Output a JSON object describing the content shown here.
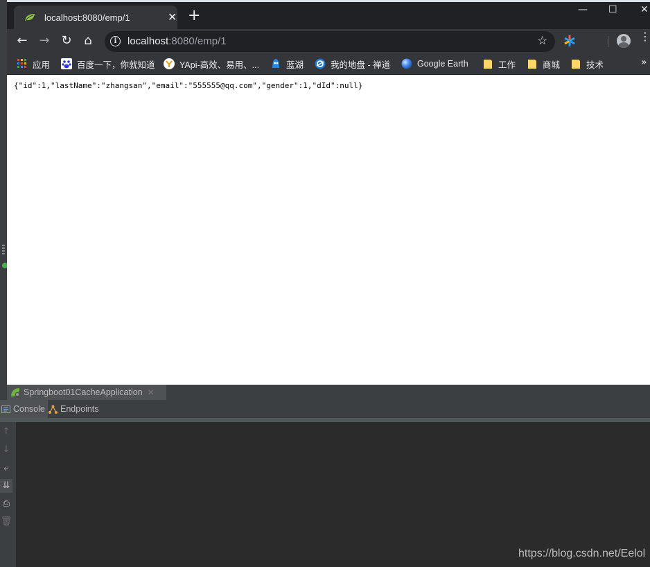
{
  "browser": {
    "tab": {
      "title": "localhost:8080/emp/1",
      "close": "✕"
    },
    "new_tab": "+",
    "window_controls": {
      "minimize": "—",
      "maximize": "☐",
      "close": "✕"
    },
    "toolbar": {
      "back": "←",
      "forward": "→",
      "reload": "↻",
      "home": "⌂",
      "url_host": "localhost",
      "url_path": ":8080/emp/1",
      "info": "i",
      "star": "☆",
      "menu": "⋮"
    },
    "bookmarks": [
      {
        "label": "应用",
        "icon": "apps-grid-icon"
      },
      {
        "label": "百度一下，你就知道",
        "icon": "baidu-paw-icon"
      },
      {
        "label": "YApi-高效、易用、...",
        "icon": "yapi-icon"
      },
      {
        "label": "蓝湖",
        "icon": "lanhu-icon"
      },
      {
        "label": "我的地盘 - 禅道",
        "icon": "zentao-icon"
      },
      {
        "label": "Google Earth",
        "icon": "google-earth-icon"
      },
      {
        "label": "工作",
        "icon": "folder-icon"
      },
      {
        "label": "商城",
        "icon": "folder-icon"
      },
      {
        "label": "技术",
        "icon": "folder-icon"
      }
    ],
    "bookmarks_more": "»",
    "page_body": "{\"id\":1,\"lastName\":\"zhangsan\",\"email\":\"555555@qq.com\",\"gender\":1,\"dId\":null}"
  },
  "ide": {
    "run_tab": {
      "label": "Springboot01CacheApplication",
      "close": "✕"
    },
    "sub_tabs": [
      {
        "label": "Console",
        "active": true
      },
      {
        "label": "Endpoints",
        "active": false
      }
    ],
    "gutter_buttons": [
      "↑",
      "↓",
      "⤶",
      "⇊",
      "⎙",
      "🗑"
    ]
  },
  "watermark": "https://blog.csdn.net/Eelol",
  "colors": {
    "chrome_dark": "#202124",
    "chrome_toolbar": "#35363a",
    "ide_panel": "#3c3f41",
    "console_bg": "#2b2b2b"
  }
}
